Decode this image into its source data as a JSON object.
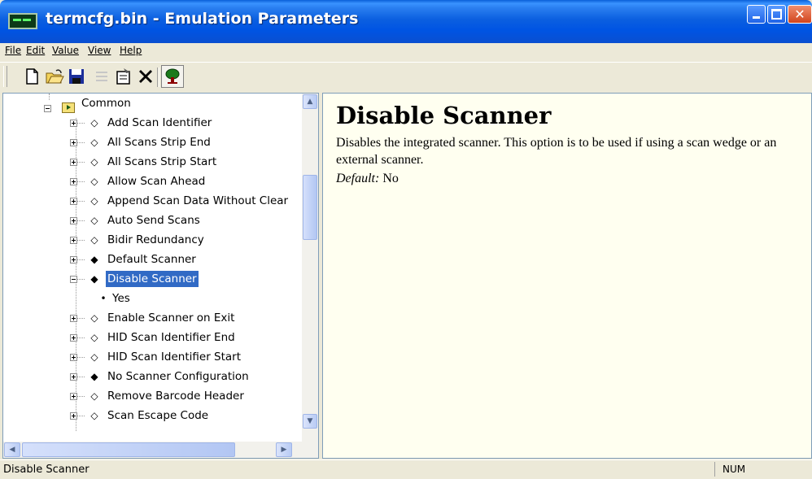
{
  "window": {
    "title": "termcfg.bin - Emulation Parameters"
  },
  "menu": [
    "File",
    "Edit",
    "Value",
    "View",
    "Help"
  ],
  "toolbar": {
    "buttons": [
      "new-icon",
      "open-icon",
      "save-icon",
      "list-icon",
      "properties-icon",
      "delete-icon",
      "tree-icon"
    ]
  },
  "tree": {
    "root": "Common",
    "items": [
      {
        "label": "Add Scan Identifier",
        "icon": "diamond-outline"
      },
      {
        "label": "All Scans Strip End",
        "icon": "diamond-outline"
      },
      {
        "label": "All Scans Strip Start",
        "icon": "diamond-outline"
      },
      {
        "label": "Allow Scan Ahead",
        "icon": "diamond-outline"
      },
      {
        "label": "Append Scan Data Without Clear",
        "icon": "diamond-outline"
      },
      {
        "label": "Auto Send Scans",
        "icon": "diamond-outline"
      },
      {
        "label": "Bidir Redundancy",
        "icon": "diamond-outline"
      },
      {
        "label": "Default Scanner",
        "icon": "diamond-filled"
      },
      {
        "label": "Disable Scanner",
        "icon": "diamond-filled",
        "selected": true,
        "child": "Yes"
      },
      {
        "label": "Enable Scanner on Exit",
        "icon": "diamond-outline"
      },
      {
        "label": "HID Scan Identifier End",
        "icon": "diamond-outline"
      },
      {
        "label": "HID Scan Identifier Start",
        "icon": "diamond-outline"
      },
      {
        "label": "No Scanner Configuration",
        "icon": "diamond-filled"
      },
      {
        "label": "Remove Barcode Header",
        "icon": "diamond-outline"
      },
      {
        "label": "Scan Escape Code",
        "icon": "diamond-outline"
      }
    ]
  },
  "detail": {
    "title": "Disable Scanner",
    "description": "Disables the integrated scanner. This option is to be used if using a scan wedge or an external scanner.",
    "default_label": "Default:",
    "default_value": "No"
  },
  "status": {
    "text": "Disable Scanner",
    "num": "NUM"
  }
}
